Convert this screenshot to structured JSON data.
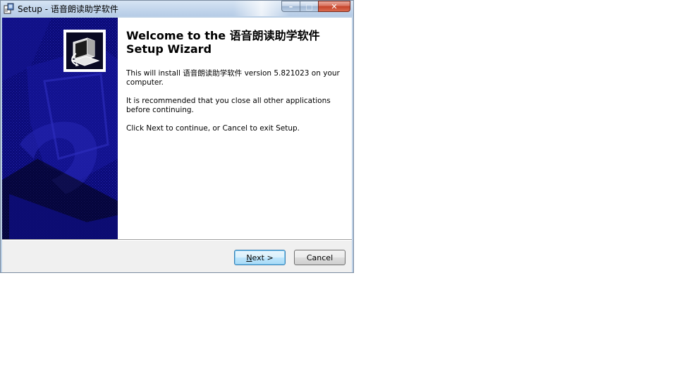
{
  "window": {
    "title": "Setup - 语音朗读助学软件",
    "caption_buttons": {
      "minimize_glyph": "–",
      "maximize_glyph": "□",
      "close_glyph": "✕"
    }
  },
  "wizard": {
    "heading": "Welcome to the 语音朗读助学软件 Setup Wizard",
    "paragraphs": [
      "This will install 语音朗读助学软件 version 5.821023 on your computer.",
      "It is recommended that you close all other applications before continuing.",
      "Click Next to continue, or Cancel to exit Setup."
    ],
    "logo_icon": "computer-install-icon"
  },
  "buttons": {
    "next_mnemonic": "N",
    "next_rest": "ext >",
    "cancel": "Cancel"
  },
  "colors": {
    "side_panel": "#0b0b7a",
    "default_button_border": "#3c7fb1"
  }
}
